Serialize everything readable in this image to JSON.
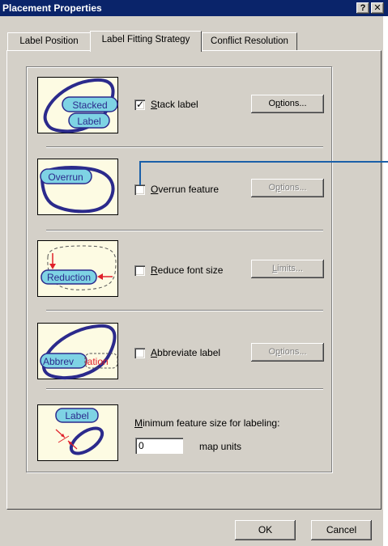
{
  "window": {
    "title": "Placement Properties",
    "help_glyph": "?",
    "close_glyph": "✕"
  },
  "tabs": [
    {
      "label": "Label Position"
    },
    {
      "label": "Label Fitting Strategy"
    },
    {
      "label": "Conflict Resolution"
    }
  ],
  "sections": {
    "stack": {
      "icon_text_1": "Stacked",
      "icon_text_2": "Label",
      "checkbox_label": "Stack label",
      "checked": true,
      "button_label": "Options...",
      "button_enabled": true
    },
    "overrun": {
      "icon_text": "Overrun",
      "checkbox_label": "Overrun feature",
      "checked": false,
      "button_label": "Options...",
      "button_enabled": false
    },
    "reduction": {
      "icon_text": "Reduction",
      "checkbox_label": "Reduce font size",
      "checked": false,
      "button_label": "Limits...",
      "button_enabled": false
    },
    "abbreviation": {
      "icon_text_1": "Abbrev",
      "icon_text_2": "iation",
      "checkbox_label": "Abbreviate label",
      "checked": false,
      "button_label": "Options...",
      "button_enabled": false
    },
    "minimum": {
      "icon_text": "Label",
      "caption": "Minimum feature size for labeling:",
      "value": "0",
      "units": "map units"
    }
  },
  "footer": {
    "ok_label": "OK",
    "cancel_label": "Cancel"
  },
  "colors": {
    "titlebar": "#0a246a",
    "dialog_bg": "#d4d0c8",
    "icon_bg": "#fdfbe3",
    "feature_stroke": "#2b2a8c",
    "label_fill": "#7ed3e4",
    "arrow_red": "#e0202a",
    "callout_line": "#1a5fa8"
  }
}
